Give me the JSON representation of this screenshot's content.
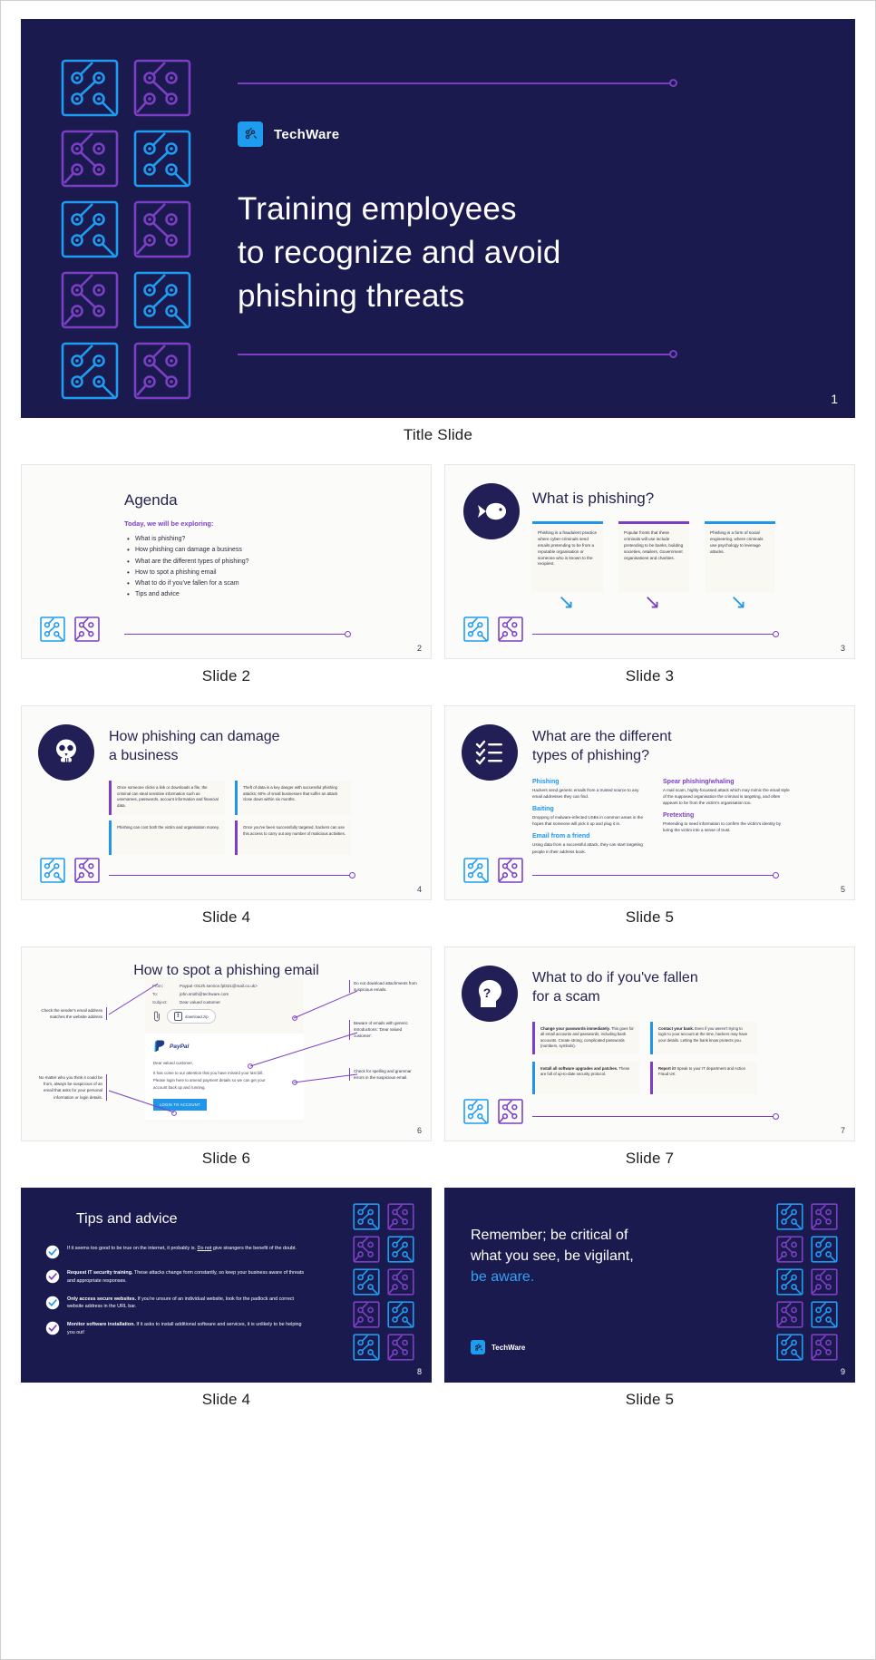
{
  "brand": {
    "name": "TechWare",
    "accent_blue": "#1e9cf0",
    "accent_purple": "#7b3fc4",
    "dark_navy": "#1b1a4e"
  },
  "slides": [
    {
      "number": "1",
      "caption": "Title Slide",
      "brand": "TechWare",
      "title_line1": "Training employees",
      "title_line2": "to recognize and avoid",
      "title_line3": "phishing threats"
    },
    {
      "number": "2",
      "caption": "Slide 2",
      "title": "Agenda",
      "subtitle": "Today, we will be exploring:",
      "bullets": [
        "What is phishing?",
        "How phishing can damage a business",
        "What are the different types of phishing?",
        "How to spot a phishing email",
        "What to do if you've fallen for a scam",
        "Tips and advice"
      ]
    },
    {
      "number": "3",
      "caption": "Slide 3",
      "title": "What is phishing?",
      "icon": "fish-icon",
      "cards": [
        {
          "color": "#2196e8",
          "text": "Phishing is a fraudulent practice where cyber-criminals send emails pretending to be from a reputable organisation or someone who is known to the recipient."
        },
        {
          "color": "#7b3fc4",
          "text": "Popular fronts that these criminals will use include pretending to be banks, building societies, retailers, Government organisations and charities."
        },
        {
          "color": "#2196e8",
          "text": "Phishing is a form of social engineering, where criminals use psychology to leverage attacks."
        }
      ]
    },
    {
      "number": "4",
      "caption": "Slide 4",
      "title_line1": "How phishing can damage",
      "title_line2": "a business",
      "icon": "skull-icon",
      "cards": [
        {
          "color": "#7b3fc4",
          "text": "Once someone clicks a link or downloads a file, the criminal can steal sensitive information such as usernames, passwords, account information and financial data."
        },
        {
          "color": "#2196e8",
          "text": "Theft of data is a key danger with successful phishing attacks; 60% of small businesses that suffer an attack close down within six months."
        },
        {
          "color": "#2196e8",
          "text": "Phishing can cost both the victim and organisation money."
        },
        {
          "color": "#7b3fc4",
          "text": "Once you've been successfully targeted, hackers can use this access to carry out any number of malicious activities."
        }
      ]
    },
    {
      "number": "5",
      "caption": "Slide 5",
      "title_line1": "What are the different",
      "title_line2": "types of phishing?",
      "icon": "checklist-icon",
      "types_left": [
        {
          "head": "Phishing",
          "color": "#2196e8",
          "body": "Hackers send generic emails from a trusted source to any email addresses they can find."
        },
        {
          "head": "Baiting",
          "color": "#2196e8",
          "body": "Dropping of malware-infected USBs in common areas in the hopes that someone will pick it up and plug it in."
        },
        {
          "head": "Email from a friend",
          "color": "#2196e8",
          "body": "Using data from a successful attack, they can start targeting people in their address book."
        }
      ],
      "types_right": [
        {
          "head": "Spear phishing/whaling",
          "color": "#7b3fc4",
          "body": "A mail scam, highly-focussed attack which may mimic the email style of the supposed organisation the criminal is targeting, and often appears to be from the victim's organisation too."
        },
        {
          "head": "Pretexting",
          "color": "#7b3fc4",
          "body": "Pretending to need information to confirm the victim's identity by luring the victim into a sense of trust."
        }
      ]
    },
    {
      "number": "6",
      "caption": "Slide 6",
      "title": "How to spot a phishing email",
      "email": {
        "from_label": "From:",
        "from_value": "Paypal <012h.service.fpl321@mail.co.uk>",
        "to_label": "To:",
        "to_value": "john.smith@techware.com",
        "subject_label": "Subject:",
        "subject_value": "Dear valued customer",
        "attachment": "download.zip",
        "logo": "PayPal",
        "greeting": "Dear valued customer,",
        "body1": "It has come to our attention that you have missed your last bill.",
        "body2": "Please login here to amend payment details so we can get your",
        "body3": "account back up and running.",
        "cta": "LOGIN TO ACCOUNT"
      },
      "annotations": [
        "Check the sender's email address matches the website address",
        "No matter who you think it could be from, always be suspicious of an email that asks for your personal information or login details.",
        "Do not download attachments from suspicious emails.",
        "Beware of emails with generic introductions: 'Dear valued customer'.",
        "Check for spelling and grammar errors in the suspicious email."
      ]
    },
    {
      "number": "7",
      "caption": "Slide 7",
      "title_line1": "What to do if you've fallen",
      "title_line2": "for a scam",
      "icon": "question-head-icon",
      "cards": [
        {
          "color": "#7b3fc4",
          "bold": "Change your passwords immediately.",
          "text": "This goes for all email accounts and passwords, including bank accounts. Create strong, complicated passwords (numbers, symbols)."
        },
        {
          "color": "#2196e8",
          "bold": "Contact your bank.",
          "text": "Even if you weren't trying to login to your account at the time, hackers may have your details. Letting the bank know protects you."
        },
        {
          "color": "#2196e8",
          "bold": "Install all software upgrades and patches.",
          "text": "These are full of up-to-date security protocol."
        },
        {
          "color": "#7b3fc4",
          "bold": "Report it!",
          "text": "Speak to your IT department and Action Fraud UK."
        }
      ]
    },
    {
      "number": "8",
      "caption": "Slide 4",
      "title": "Tips and advice",
      "tips": [
        {
          "check": "#2196e8",
          "bold": "",
          "text": "If it seems too good to be true on the internet, it probably is. ",
          "underline": "Do not",
          "text2": " give strangers the benefit of the doubt."
        },
        {
          "check": "#7b3fc4",
          "bold": "Request IT security training.",
          "text": " These attacks change form constantly, so keep your business aware of threats and appropriate responses."
        },
        {
          "check": "#2196e8",
          "bold": "Only access secure websites.",
          "text": " If you're unsure of an individual website, look for the padlock and correct website address in the URL bar."
        },
        {
          "check": "#7b3fc4",
          "bold": "Monitor software installation.",
          "text": " If it asks to install additional software and services, it is unlikely to be helping you out!"
        }
      ]
    },
    {
      "number": "9",
      "caption": "Slide 5",
      "line1": "Remember; be critical of",
      "line2": "what you see, be vigilant,",
      "line3": "be aware.",
      "brand": "TechWare"
    }
  ]
}
